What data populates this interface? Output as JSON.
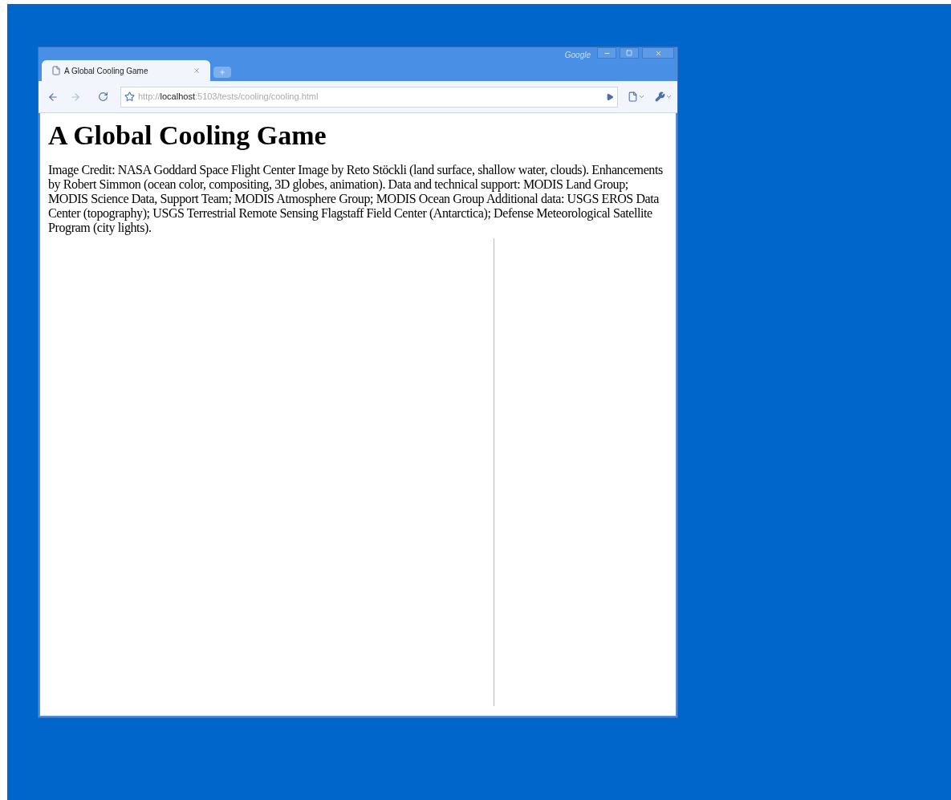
{
  "window": {
    "brand": "Google"
  },
  "tabs": [
    {
      "title": "A Global Cooling Game",
      "selected": true
    }
  ],
  "address_bar": {
    "scheme": "http://",
    "host": "localhost",
    "path": ":5103/tests/cooling/cooling.html"
  },
  "page": {
    "heading": "A Global Cooling Game",
    "credit": "Image Credit: NASA Goddard Space Flight Center Image by Reto Stöckli (land surface, shallow water, clouds). Enhancements by Robert Simmon (ocean color, compositing, 3D globes, animation). Data and technical support: MODIS Land Group; MODIS Science Data, Support Team; MODIS Atmosphere Group; MODIS Ocean Group Additional data: USGS EROS Data Center (topography); USGS Terrestrial Remote Sensing Flagstaff Field Center (Antarctica); Defense Meteorological Satellite Program (city lights)."
  }
}
